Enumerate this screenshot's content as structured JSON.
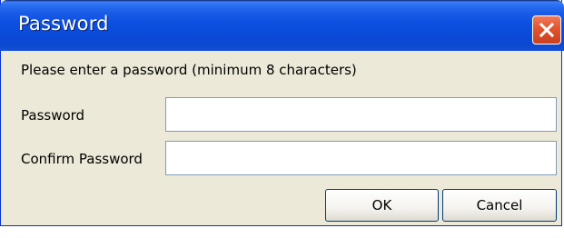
{
  "window": {
    "title": "Password",
    "close_icon": "close-icon",
    "accent_color": "#0a4fe0",
    "close_color": "#e2532f"
  },
  "dialog": {
    "prompt": "Please enter a password (minimum 8 characters)",
    "password_label": "Password",
    "password_value": "",
    "confirm_label": "Confirm Password",
    "confirm_value": "",
    "ok_label": "OK",
    "cancel_label": "Cancel"
  }
}
